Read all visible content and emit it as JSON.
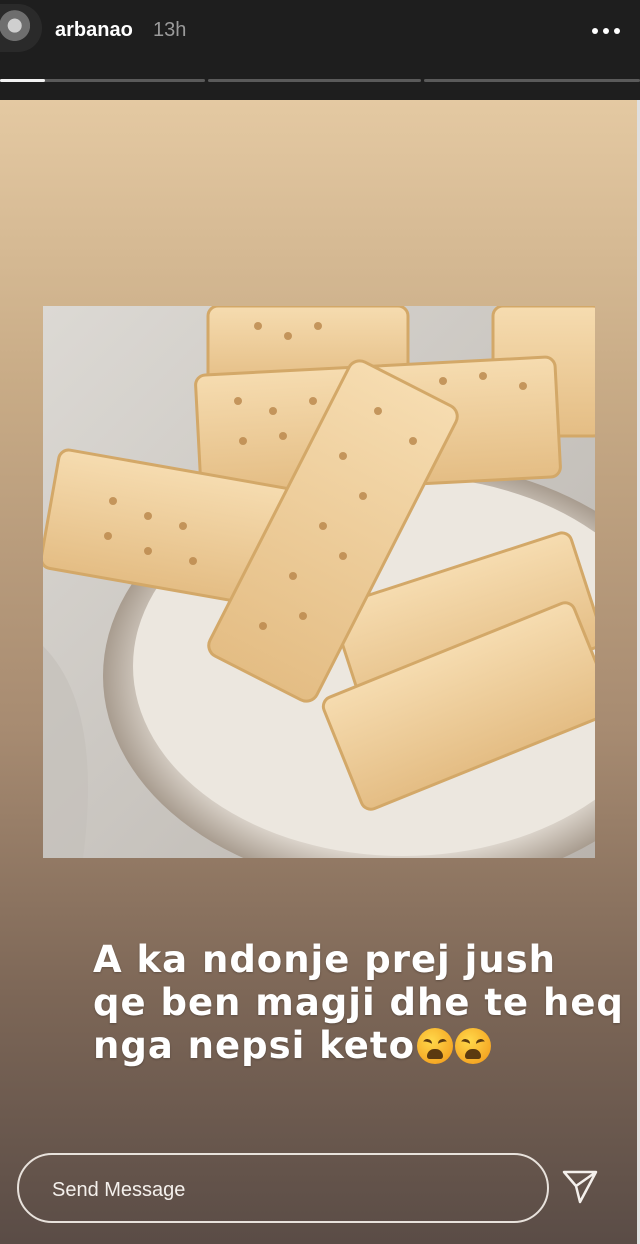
{
  "header": {
    "username": "arbanao",
    "timestamp": "13h",
    "more_icon": "more-horizontal-icon",
    "story_segments": [
      {
        "progress": 0.22
      },
      {
        "progress": 0
      },
      {
        "progress": 0
      }
    ]
  },
  "story": {
    "caption_lines": [
      "A ka ndonje prej jush",
      "qe ben magji dhe te heq",
      "nga nepsi keto"
    ],
    "caption_emojis": [
      "weary-face-emoji",
      "weary-face-emoji"
    ],
    "colors": {
      "gradient_top": "#e4c9a2",
      "gradient_bottom": "#5a4c46",
      "header_bg": "#1e1e1e"
    }
  },
  "footer": {
    "message_placeholder": "Send Message",
    "send_icon": "paper-plane-icon"
  }
}
